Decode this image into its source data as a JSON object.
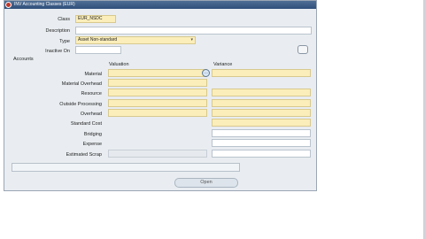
{
  "window": {
    "title": "INV Accounting Classes (EUR)"
  },
  "form": {
    "class_label": "Class",
    "class_value": "EUR_NSDC",
    "description_label": "Description",
    "description_value": "",
    "type_label": "Type",
    "type_value": "Asset Non-standard",
    "inactive_label": "Inactive On",
    "inactive_value": ""
  },
  "accounts": {
    "group_label": "Accounts",
    "valuation_header": "Valuation",
    "variance_header": "Variance",
    "rows": [
      {
        "label": "Material"
      },
      {
        "label": "Material Overhead"
      },
      {
        "label": "Resource"
      },
      {
        "label": "Outside Processing"
      },
      {
        "label": "Overhead"
      },
      {
        "label": "Standard Cost"
      },
      {
        "label": "Bridging"
      },
      {
        "label": "Expense"
      },
      {
        "label": "Estimated Scrap"
      }
    ]
  },
  "buttons": {
    "open_label": "Open",
    "lov_glyph": "…"
  }
}
